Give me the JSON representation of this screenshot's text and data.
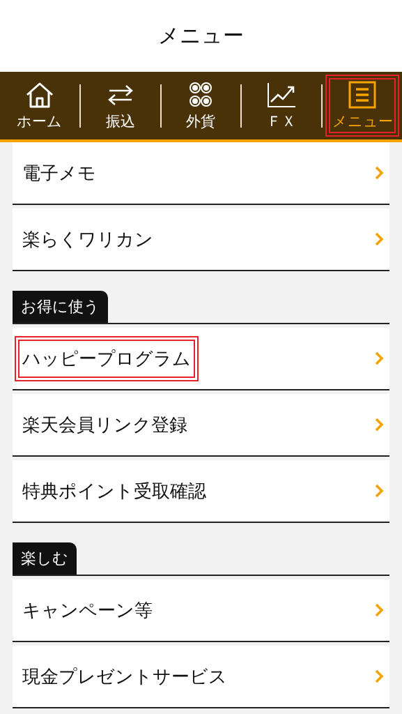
{
  "header": {
    "title": "メニュー"
  },
  "tabs": [
    {
      "label": "ホーム",
      "kind": "home",
      "selected": false,
      "highlighted": false
    },
    {
      "label": "振込",
      "kind": "transfer",
      "selected": false,
      "highlighted": false
    },
    {
      "label": "外貨",
      "kind": "currency",
      "selected": false,
      "highlighted": false
    },
    {
      "label": "ＦＸ",
      "kind": "chart",
      "selected": false,
      "highlighted": false
    },
    {
      "label": "メニュー",
      "kind": "menu",
      "selected": true,
      "highlighted": true
    }
  ],
  "sections": [
    {
      "items": [
        {
          "label": "電子メモ",
          "highlighted": false
        },
        {
          "label": "楽らくワリカン",
          "highlighted": false
        }
      ]
    },
    {
      "heading": "お得に使う",
      "items": [
        {
          "label": "ハッピープログラム",
          "highlighted": true
        },
        {
          "label": "楽天会員リンク登録",
          "highlighted": false
        },
        {
          "label": "特典ポイント受取確認",
          "highlighted": false
        }
      ]
    },
    {
      "heading": "楽しむ",
      "items": [
        {
          "label": "キャンペーン等",
          "highlighted": false
        },
        {
          "label": "現金プレゼントサービス",
          "highlighted": false
        }
      ]
    }
  ]
}
